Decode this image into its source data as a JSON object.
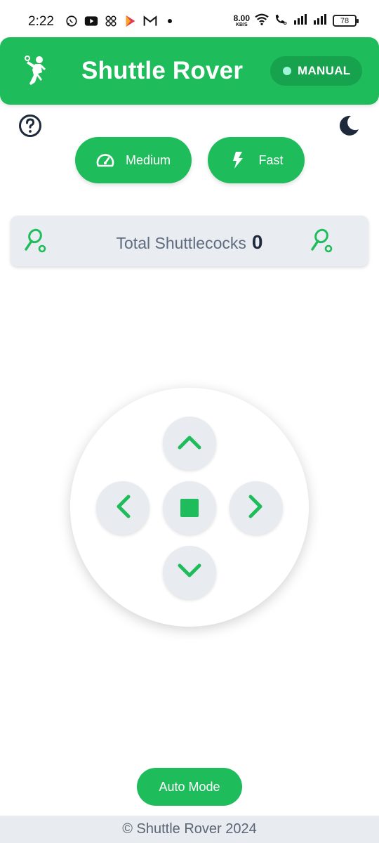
{
  "status_bar": {
    "time": "2:22",
    "net_speed_value": "8.00",
    "net_speed_unit": "KB/S",
    "battery": "78",
    "app_icons": [
      "whatsapp-icon",
      "youtube-icon",
      "apps-icon",
      "play-store-icon",
      "gmail-icon",
      "dot-icon"
    ],
    "right_icons": [
      "wifi-icon",
      "volte-call-icon",
      "signal-icon",
      "signal-icon"
    ]
  },
  "header": {
    "title": "Shuttle Rover",
    "mode_label": "MANUAL",
    "logo_icon": "badminton-player-icon"
  },
  "toolbar": {
    "help_icon": "help-circle-icon",
    "theme_icon": "moon-icon"
  },
  "speed": {
    "medium_label": "Medium",
    "fast_label": "Fast",
    "medium_icon": "speedometer-icon",
    "fast_icon": "lightning-icon"
  },
  "counter": {
    "label": "Total Shuttlecocks",
    "value": "0"
  },
  "controls": {
    "up_icon": "chevron-up-icon",
    "down_icon": "chevron-down-icon",
    "left_icon": "chevron-left-icon",
    "right_icon": "chevron-right-icon",
    "stop_icon": "stop-icon"
  },
  "auto_mode": {
    "label": "Auto Mode"
  },
  "footer": {
    "text": "© Shuttle Rover 2024"
  },
  "colors": {
    "primary": "#1fbc5c",
    "primary_dark": "#17a24e",
    "mode_dot": "#9ff5d8",
    "card_bg": "#e9edf2",
    "text_dark": "#1e293b",
    "text_muted": "#5f6b7e"
  }
}
